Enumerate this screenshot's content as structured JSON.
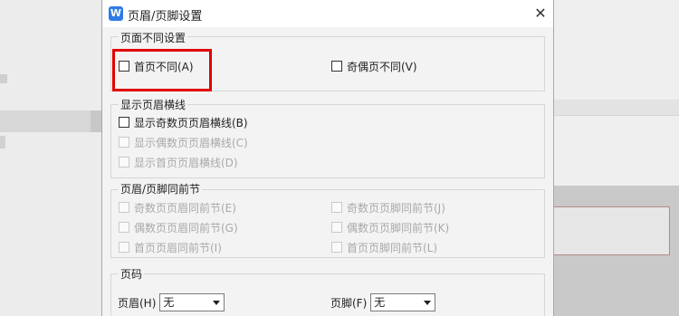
{
  "dialog": {
    "title": "页眉/页脚设置",
    "icon": "wps-app-icon",
    "close_label": "✕"
  },
  "page_different": {
    "label": "页面不同设置",
    "first_page": "首页不同(A)",
    "odd_even": "奇偶页不同(V)"
  },
  "header_line": {
    "label": "显示页眉横线",
    "odd": "显示奇数页页眉横线(B)",
    "even": "显示偶数页页眉横线(C)",
    "first": "显示首页页眉横线(D)"
  },
  "same_as_prev": {
    "label": "页眉/页脚同前节",
    "odd_header": "奇数页页眉同前节(E)",
    "odd_footer": "奇数页页脚同前节(J)",
    "even_header": "偶数页页眉同前节(G)",
    "even_footer": "偶数页页脚同前节(K)",
    "first_header": "首页页眉同前节(I)",
    "first_footer": "首页页脚同前节(L)"
  },
  "page_number": {
    "label": "页码",
    "header_label": "页眉(H)",
    "header_value": "无",
    "footer_label": "页脚(F)",
    "footer_value": "无"
  },
  "colors": {
    "highlight": "#e10000",
    "app_icon": "#2f7be5"
  }
}
